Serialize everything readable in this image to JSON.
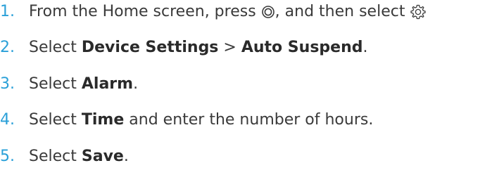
{
  "steps": [
    {
      "number": "1.",
      "pre": "From the Home screen, press",
      "mid": ", and then select",
      "icons": [
        "home-button-icon",
        "gear-icon"
      ]
    },
    {
      "number": "2.",
      "pre": "Select ",
      "bold1": "Device Settings",
      "sep": " > ",
      "bold2": "Auto Suspend",
      "post": "."
    },
    {
      "number": "3.",
      "pre": "Select ",
      "bold1": "Alarm",
      "post": "."
    },
    {
      "number": "4.",
      "pre": "Select ",
      "bold1": "Time",
      "post": " and enter the number of hours."
    },
    {
      "number": "5.",
      "pre": "Select ",
      "bold1": "Save",
      "post": "."
    }
  ],
  "colors": {
    "number": "#2aa0d8",
    "text": "#3a3a3a"
  }
}
